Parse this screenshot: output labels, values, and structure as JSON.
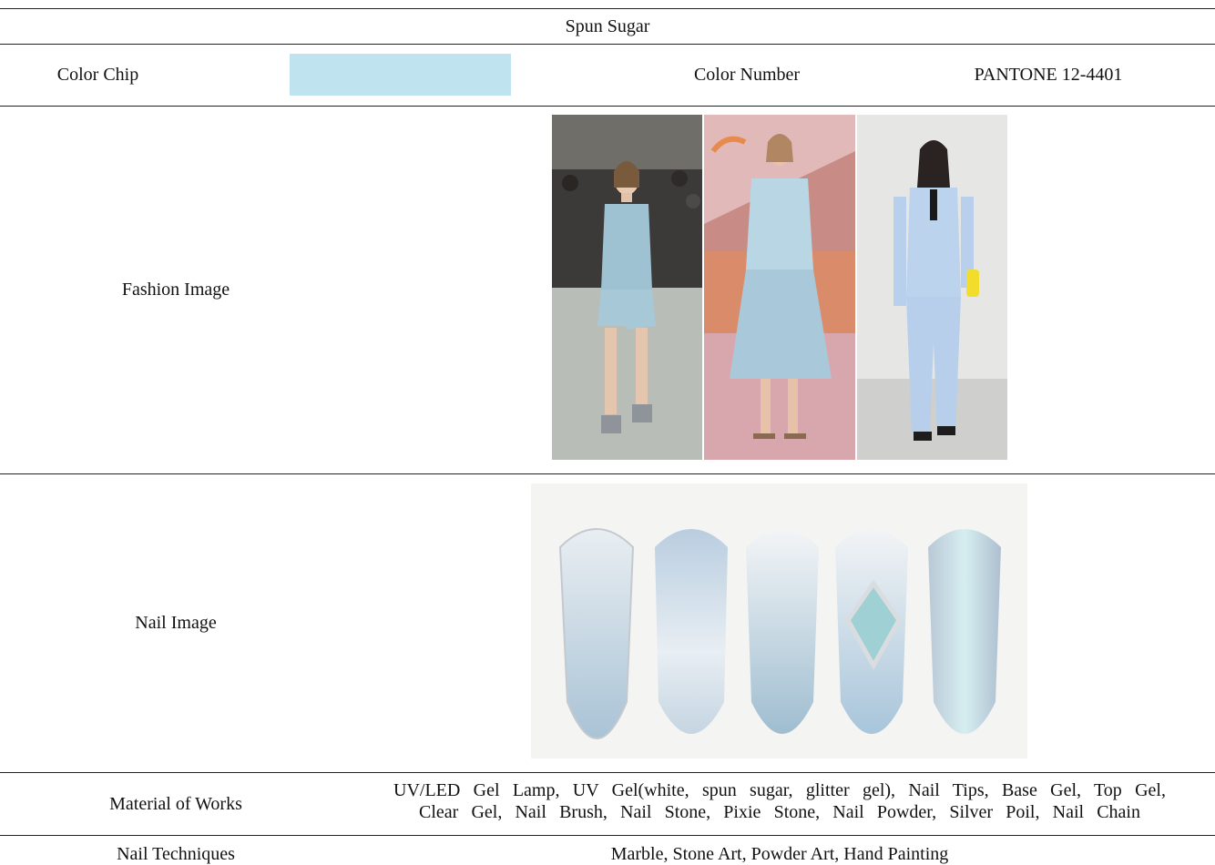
{
  "title": "Spun Sugar",
  "color_chip": {
    "label": "Color Chip",
    "color": "#bfe4f0"
  },
  "color_number": {
    "label": "Color Number",
    "value": "PANTONE 12-4401"
  },
  "fashion": {
    "label": "Fashion Image"
  },
  "nail": {
    "label": "Nail Image"
  },
  "material": {
    "label": "Material of Works",
    "lines": [
      "UV/LED Gel Lamp, UV Gel(white, spun sugar, glitter gel), Nail Tips, Base Gel, Top Gel,",
      "Clear Gel, Nail Brush, Nail Stone, Pixie Stone, Nail Powder, Silver Poil, Nail Chain"
    ]
  },
  "techniques": {
    "label": "Nail Techniques",
    "value": "Marble, Stone Art, Powder Art, Hand Painting"
  }
}
